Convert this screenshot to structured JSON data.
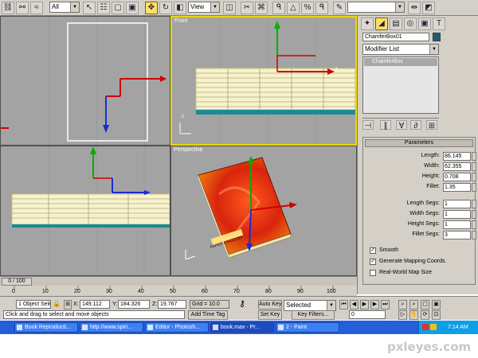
{
  "toolbar": {
    "filter_value": "All",
    "view_value": "View",
    "icons": [
      "link-icon",
      "unlink-icon",
      "bind-icon",
      "select-icon",
      "select-name-icon",
      "rect-region-icon",
      "window-icon",
      "move-icon",
      "rotate-icon",
      "scale-icon",
      "pivot-icon",
      "snap-icon",
      "angle-snap-icon",
      "percent-snap-icon",
      "spinner-snap-icon",
      "named-sel-icon",
      "mirror-icon",
      "align-icon"
    ]
  },
  "viewports": {
    "top_left": {
      "label": ""
    },
    "front": {
      "label": "Front",
      "axis_x": "x",
      "axis_y": "z"
    },
    "left": {
      "label": ""
    },
    "perspective": {
      "label": "Perspective"
    },
    "book_title": "PAPER KINGDOM"
  },
  "panel": {
    "object_name": "ChamferBox01",
    "object_color": "#1a5f7a",
    "modifier_list": "Modifier List",
    "stack_item": "ChamferBox",
    "rollout_title": "Parameters",
    "params": [
      {
        "label": "Length:",
        "value": "86.145"
      },
      {
        "label": "Width:",
        "value": "62.355"
      },
      {
        "label": "Height:",
        "value": "0.708"
      },
      {
        "label": "Fillet:",
        "value": "1.35"
      }
    ],
    "segs": [
      {
        "label": "Length Segs:",
        "value": "1"
      },
      {
        "label": "Width Segs:",
        "value": "1"
      },
      {
        "label": "Height Segs:",
        "value": "1"
      },
      {
        "label": "Fillet Segs:",
        "value": "3"
      }
    ],
    "checks": [
      {
        "label": "Smooth",
        "checked": true
      },
      {
        "label": "Generate Mapping Coords.",
        "checked": true
      },
      {
        "label": "Real-World Map Size",
        "checked": false
      }
    ]
  },
  "timeline": {
    "frame": "0 / 100",
    "ticks": [
      "0",
      "10",
      "20",
      "30",
      "40",
      "50",
      "60",
      "70",
      "80",
      "90",
      "100"
    ]
  },
  "status": {
    "selection": "1 Object Sele",
    "x": "149.112",
    "y": "184.326",
    "z": "19.767",
    "grid": "Grid = 10.0",
    "auto_key": "Auto Key",
    "selected": "Selected",
    "set_key": "Set Key",
    "key_filters": "Key Filters...",
    "frame_field": "0",
    "prompt": "Click and drag to select and move objects",
    "add_time_tag": "Add Time Tag",
    "x_label": "X:",
    "y_label": "Y:",
    "z_label": "Z:"
  },
  "taskbar": {
    "tasks": [
      {
        "label": "Book Reproducti..."
      },
      {
        "label": "http://www.spiri..."
      },
      {
        "label": "Editor - Photosh..."
      },
      {
        "label": "book.max - Pr..."
      },
      {
        "label": "2 - Paint"
      }
    ],
    "time": "7:14 AM"
  },
  "watermark": "pxleyes.com"
}
